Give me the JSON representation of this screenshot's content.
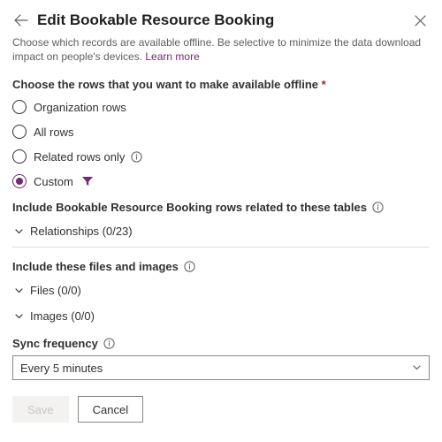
{
  "header": {
    "title": "Edit Bookable Resource Booking"
  },
  "intro": {
    "text": "Choose which records are available offline. Be selective to minimize the data download impact on people's devices. ",
    "link": "Learn more"
  },
  "rowsSection": {
    "label": "Choose the rows that you want to make available offline",
    "options": {
      "org": "Organization rows",
      "all": "All rows",
      "related": "Related rows only",
      "custom": "Custom"
    }
  },
  "includeRelated": {
    "label": "Include Bookable Resource Booking rows related to these tables",
    "relationships": "Relationships (0/23)"
  },
  "includeFiles": {
    "label": "Include these files and images",
    "files": "Files (0/0)",
    "images": "Images (0/0)"
  },
  "syncFreq": {
    "label": "Sync frequency",
    "value": "Every 5 minutes"
  },
  "footer": {
    "save": "Save",
    "cancel": "Cancel"
  }
}
